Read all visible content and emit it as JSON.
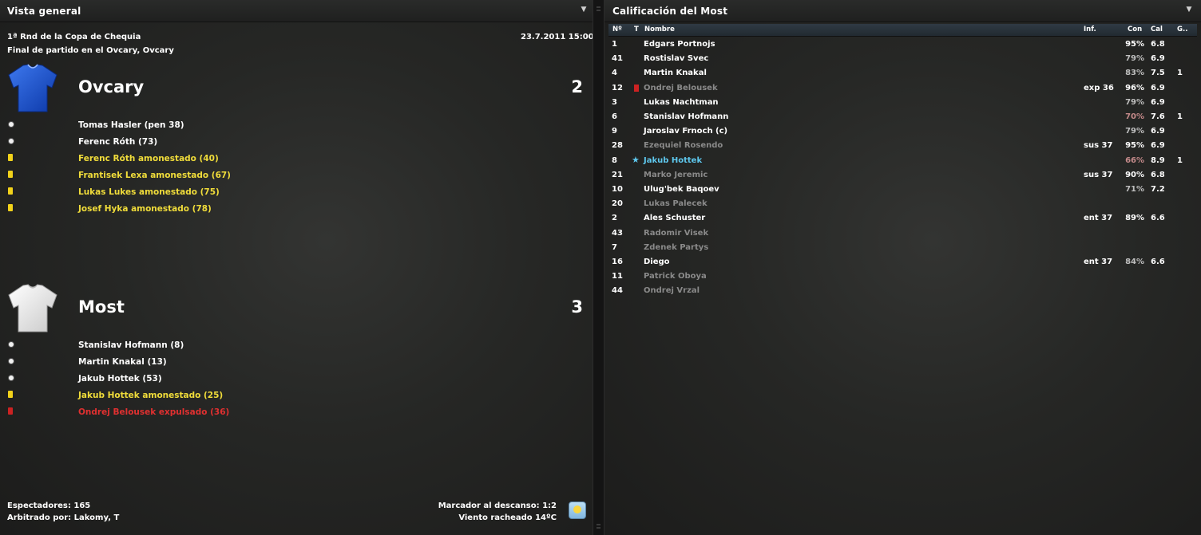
{
  "overview": {
    "title": "Vista general",
    "competition": "1ª Rnd de la Copa de Chequia",
    "datetime": "23.7.2011 15:00",
    "venue_line": "Final de partido en el Ovcary, Ovcary",
    "home": {
      "name": "Ovcary",
      "score": "2",
      "shirt_color": "#1549c8",
      "events": [
        {
          "type": "goal",
          "icon": "ball-icon",
          "text": "Tomas Hasler (pen 38)"
        },
        {
          "type": "goal",
          "icon": "ball-icon",
          "text": "Ferenc Róth (73)"
        },
        {
          "type": "yellow",
          "icon": "yellow-card-icon",
          "text": "Ferenc Róth amonestado (40)"
        },
        {
          "type": "yellow",
          "icon": "yellow-card-icon",
          "text": "Frantisek Lexa amonestado (67)"
        },
        {
          "type": "yellow",
          "icon": "yellow-card-icon",
          "text": "Lukas Lukes amonestado (75)"
        },
        {
          "type": "yellow",
          "icon": "yellow-card-icon",
          "text": "Josef Hyka amonestado (78)"
        }
      ]
    },
    "away": {
      "name": "Most",
      "score": "3",
      "shirt_color": "#f2f2f2",
      "events": [
        {
          "type": "goal",
          "icon": "ball-icon",
          "text": "Stanislav Hofmann (8)"
        },
        {
          "type": "goal",
          "icon": "ball-icon",
          "text": "Martin Knakal (13)"
        },
        {
          "type": "goal",
          "icon": "ball-icon",
          "text": "Jakub Hottek (53)"
        },
        {
          "type": "yellow",
          "icon": "yellow-card-icon",
          "text": "Jakub Hottek amonestado (25)"
        },
        {
          "type": "red",
          "icon": "red-card-icon",
          "text": "Ondrej Belousek expulsado (36)"
        }
      ]
    },
    "footer": {
      "spectators": "Espectadores: 165",
      "referee": "Arbitrado por: Lakomy, T",
      "halftime": "Marcador al descanso: 1:2",
      "weather": "Viento racheado 14ºC",
      "weather_icon": "sunny-weather-icon"
    }
  },
  "ratings": {
    "title": "Calificación del Most",
    "headers": {
      "num": "Nº",
      "t": "T",
      "name": "Nombre",
      "inf": "Inf.",
      "con": "Con",
      "cal": "Cal",
      "g": "G.."
    },
    "rows": [
      {
        "num": "1",
        "t": "",
        "name": "Edgars Portnojs",
        "inf": "",
        "con": "95%",
        "cal": "6.8",
        "g": "",
        "style": "normal",
        "con_style": "white"
      },
      {
        "num": "41",
        "t": "",
        "name": "Rostislav Svec",
        "inf": "",
        "con": "79%",
        "cal": "6.9",
        "g": "",
        "style": "normal",
        "con_style": "normal"
      },
      {
        "num": "4",
        "t": "",
        "name": "Martin Knakal",
        "inf": "",
        "con": "83%",
        "cal": "7.5",
        "g": "1",
        "style": "normal",
        "con_style": "normal"
      },
      {
        "num": "12",
        "t": "red",
        "name": "Ondrej Belousek",
        "inf": "exp 36",
        "con": "96%",
        "cal": "6.9",
        "g": "",
        "style": "dim",
        "con_style": "white"
      },
      {
        "num": "3",
        "t": "",
        "name": "Lukas Nachtman",
        "inf": "",
        "con": "79%",
        "cal": "6.9",
        "g": "",
        "style": "normal",
        "con_style": "normal"
      },
      {
        "num": "6",
        "t": "",
        "name": "Stanislav Hofmann",
        "inf": "",
        "con": "70%",
        "cal": "7.6",
        "g": "1",
        "style": "normal",
        "con_style": "low"
      },
      {
        "num": "9",
        "t": "",
        "name": "Jaroslav Frnoch (c)",
        "inf": "",
        "con": "79%",
        "cal": "6.9",
        "g": "",
        "style": "normal",
        "con_style": "normal"
      },
      {
        "num": "28",
        "t": "",
        "name": "Ezequiel Rosendo",
        "inf": "sus 37",
        "con": "95%",
        "cal": "6.9",
        "g": "",
        "style": "dim",
        "con_style": "white"
      },
      {
        "num": "8",
        "t": "star",
        "name": "Jakub Hottek",
        "inf": "",
        "con": "66%",
        "cal": "8.9",
        "g": "1",
        "style": "hl",
        "con_style": "low"
      },
      {
        "num": "21",
        "t": "",
        "name": "Marko Jeremic",
        "inf": "sus 37",
        "con": "90%",
        "cal": "6.8",
        "g": "",
        "style": "dim",
        "con_style": "white"
      },
      {
        "num": "10",
        "t": "",
        "name": "Ulug'bek Baqoev",
        "inf": "",
        "con": "71%",
        "cal": "7.2",
        "g": "",
        "style": "normal",
        "con_style": "normal"
      },
      {
        "num": "20",
        "t": "",
        "name": "Lukas Palecek",
        "inf": "",
        "con": "",
        "cal": "",
        "g": "",
        "style": "dim",
        "con_style": "normal"
      },
      {
        "num": "2",
        "t": "",
        "name": "Ales Schuster",
        "inf": "ent 37",
        "con": "89%",
        "cal": "6.6",
        "g": "",
        "style": "normal",
        "con_style": "white"
      },
      {
        "num": "43",
        "t": "",
        "name": "Radomir Visek",
        "inf": "",
        "con": "",
        "cal": "",
        "g": "",
        "style": "dim",
        "con_style": "normal"
      },
      {
        "num": "7",
        "t": "",
        "name": "Zdenek Partys",
        "inf": "",
        "con": "",
        "cal": "",
        "g": "",
        "style": "dim",
        "con_style": "normal"
      },
      {
        "num": "16",
        "t": "",
        "name": "Diego",
        "inf": "ent 37",
        "con": "84%",
        "cal": "6.6",
        "g": "",
        "style": "normal",
        "con_style": "normal"
      },
      {
        "num": "11",
        "t": "",
        "name": "Patrick Oboya",
        "inf": "",
        "con": "",
        "cal": "",
        "g": "",
        "style": "dim",
        "con_style": "normal"
      },
      {
        "num": "44",
        "t": "",
        "name": "Ondrej Vrzal",
        "inf": "",
        "con": "",
        "cal": "",
        "g": "",
        "style": "dim",
        "con_style": "normal"
      }
    ]
  },
  "colors": {
    "yellow_text": "#f0dc3a",
    "red_text": "#e03030",
    "highlight": "#5ec8ee",
    "dim_text": "#8a8a8a"
  }
}
